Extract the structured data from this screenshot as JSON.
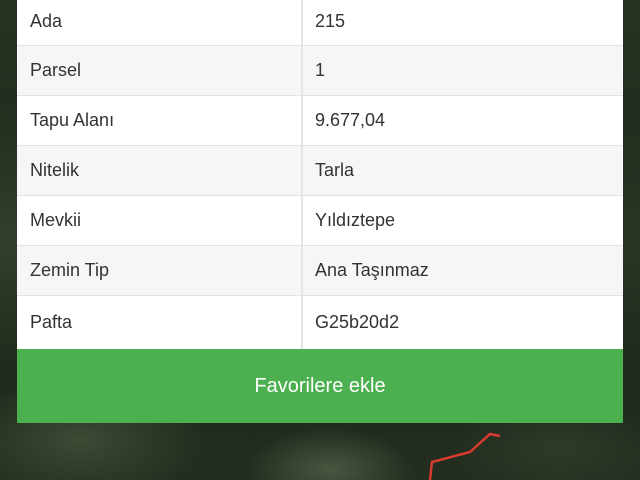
{
  "parcel_info": {
    "rows": [
      {
        "label": "Ada",
        "value": "215"
      },
      {
        "label": "Parsel",
        "value": "1"
      },
      {
        "label": "Tapu Alanı",
        "value": "9.677,04"
      },
      {
        "label": "Nitelik",
        "value": "Tarla"
      },
      {
        "label": "Mevkii",
        "value": "Yıldıztepe"
      },
      {
        "label": "Zemin Tip",
        "value": "Ana Taşınmaz"
      },
      {
        "label": "Pafta",
        "value": "G25b20d2"
      }
    ]
  },
  "actions": {
    "favorite_label": "Favorilere ekle"
  },
  "colors": {
    "button_green": "#4caf50",
    "parcel_boundary": "#d83a2e"
  }
}
